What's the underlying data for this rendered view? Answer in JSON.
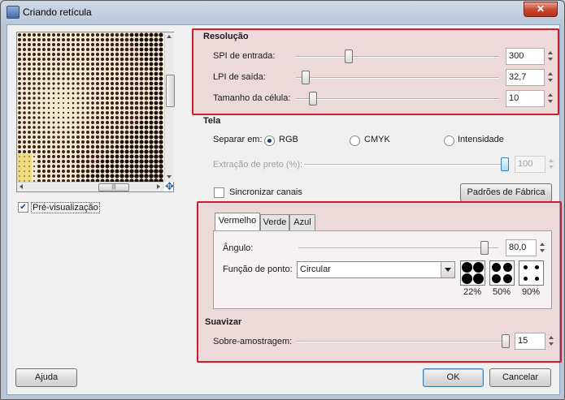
{
  "window": {
    "title": "Criando retícula",
    "close_label": "✕"
  },
  "preview": {
    "checkbox_label": "Pré-visualização",
    "checked": true,
    "hscroll_grip": "|||",
    "move_icon": "✥"
  },
  "resolucao": {
    "heading": "Resolução",
    "spi": {
      "label": "SPI de entrada:",
      "value": "300"
    },
    "lpi": {
      "label": "LPI de saída:",
      "value": "32,7"
    },
    "cell": {
      "label": "Tamanho da célula:",
      "value": "10"
    }
  },
  "tela": {
    "heading": "Tela",
    "separar_label": "Separar em:",
    "options": [
      "RGB",
      "CMYK",
      "Intensidade"
    ],
    "selected": "RGB",
    "extracao": {
      "label": "Extração de preto (%):",
      "value": "100"
    },
    "sincronizar_label": "Sincronizar canais",
    "padroes_button": "Padrões de Fábrica"
  },
  "tabs": [
    {
      "label": "Vermelho",
      "active": true
    },
    {
      "label": "Verde",
      "active": false
    },
    {
      "label": "Azul",
      "active": false
    }
  ],
  "angulo": {
    "label": "Ângulo:",
    "value": "80,0"
  },
  "funcao": {
    "label": "Função de ponto:",
    "selected": "Circular",
    "swatches": [
      "22%",
      "50%",
      "90%"
    ]
  },
  "suavizar": {
    "heading": "Suavizar",
    "sobre": {
      "label": "Sobre-amostragem:",
      "value": "15"
    }
  },
  "buttons": {
    "help": "Ajuda",
    "ok": "OK",
    "cancel": "Cancelar"
  },
  "colors": {
    "highlight": "#d21b2b",
    "accent": "#3c7fb1"
  }
}
